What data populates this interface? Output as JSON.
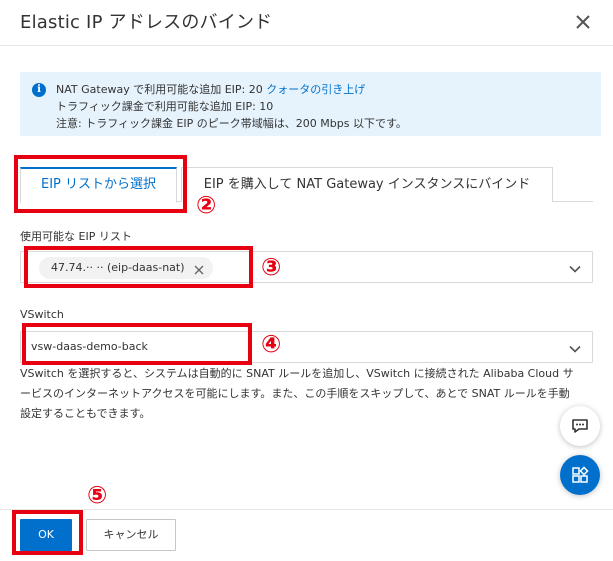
{
  "dialog": {
    "title": "Elastic IP アドレスのバインド"
  },
  "info": {
    "line1_text": "NAT Gateway で利用可能な追加 EIP: 20",
    "line1_link": "クォータの引き上げ",
    "line2": "トラフィック課金で利用可能な追加 EIP: 10",
    "line3": "注意: トラフィック課金 EIP のピーク帯域幅は、200 Mbps 以下です。"
  },
  "tabs": [
    {
      "label": "EIP リストから選択",
      "active": true
    },
    {
      "label": "EIP を購入して NAT Gateway インスタンスにバインド",
      "active": false
    }
  ],
  "eip": {
    "label": "使用可能な EIP リスト",
    "selected_tag": "47.74.·· ·· (eip-daas-nat)"
  },
  "vswitch": {
    "label": "VSwitch",
    "value": "vsw-daas-demo-back",
    "hint": "VSwitch を選択すると、システムは自動的に SNAT ルールを追加し、VSwitch に接続された Alibaba Cloud サービスのインターネットアクセスを可能にします。また、この手順をスキップして、あとで SNAT ルールを手動設定することもできます。"
  },
  "footer": {
    "ok_label": "OK",
    "cancel_label": "キャンセル"
  },
  "annotations": {
    "n2": "②",
    "n3": "③",
    "n4": "④",
    "n5": "⑤"
  },
  "icons": {
    "info": "info-icon",
    "close": "close-icon",
    "chevron": "chevron-down-icon",
    "chat": "chat-icon",
    "apps": "apps-icon"
  },
  "colors": {
    "accent": "#0070cc",
    "annotation": "#e60012",
    "info_bg": "#e6f3fc"
  }
}
